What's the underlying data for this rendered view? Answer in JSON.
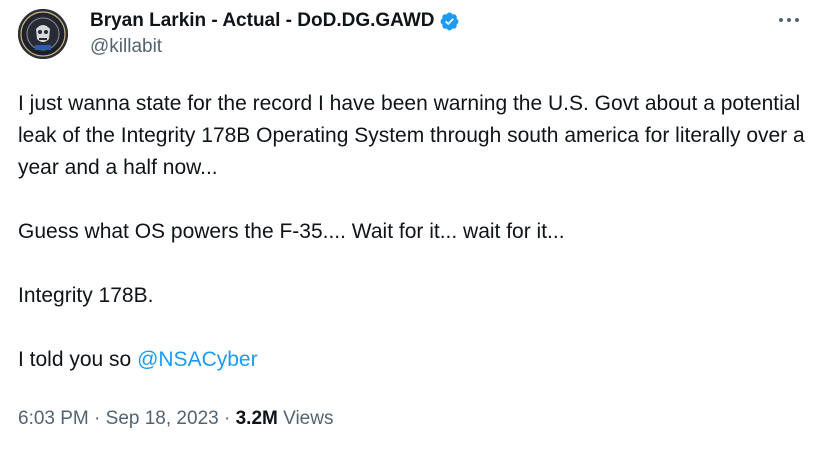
{
  "author": {
    "display_name": "Bryan Larkin - Actual - DoD.DG.GAWD",
    "handle": "@killabit",
    "verified": true,
    "verified_color": "#1d9bf0"
  },
  "tweet": {
    "paragraphs": [
      "I just wanna state for the record I have been warning the U.S. Govt about a potential leak of the Integrity 178B Operating System through south america for literally over a year and a half now...",
      "Guess what OS powers the F-35.... Wait for it... wait for it...",
      "Integrity 178B."
    ],
    "last_line_prefix": "I told you so ",
    "mention": "@NSACyber",
    "mention_color": "#1d9bf0"
  },
  "meta": {
    "time": "6:03 PM",
    "separator": "·",
    "date": "Sep 18, 2023",
    "views_count": "3.2M",
    "views_label": "Views"
  },
  "icons": {
    "more": "more-horizontal-icon",
    "verified": "verified-badge-icon"
  }
}
